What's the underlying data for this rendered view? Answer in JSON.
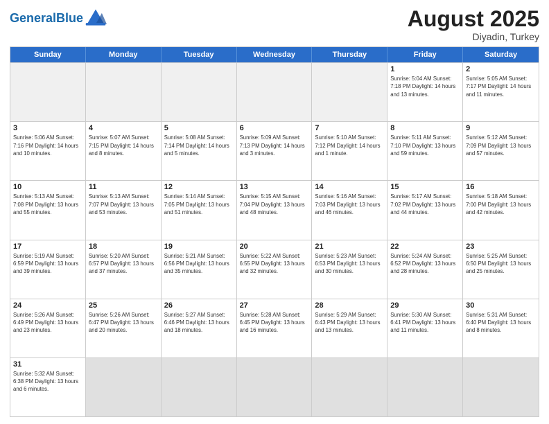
{
  "header": {
    "logo_general": "General",
    "logo_blue": "Blue",
    "title": "August 2025",
    "location": "Diyadin, Turkey"
  },
  "days_of_week": [
    "Sunday",
    "Monday",
    "Tuesday",
    "Wednesday",
    "Thursday",
    "Friday",
    "Saturday"
  ],
  "weeks": [
    [
      {
        "day": "",
        "info": "",
        "empty": true
      },
      {
        "day": "",
        "info": "",
        "empty": true
      },
      {
        "day": "",
        "info": "",
        "empty": true
      },
      {
        "day": "",
        "info": "",
        "empty": true
      },
      {
        "day": "",
        "info": "",
        "empty": true
      },
      {
        "day": "1",
        "info": "Sunrise: 5:04 AM\nSunset: 7:18 PM\nDaylight: 14 hours\nand 13 minutes."
      },
      {
        "day": "2",
        "info": "Sunrise: 5:05 AM\nSunset: 7:17 PM\nDaylight: 14 hours\nand 11 minutes."
      }
    ],
    [
      {
        "day": "3",
        "info": "Sunrise: 5:06 AM\nSunset: 7:16 PM\nDaylight: 14 hours\nand 10 minutes."
      },
      {
        "day": "4",
        "info": "Sunrise: 5:07 AM\nSunset: 7:15 PM\nDaylight: 14 hours\nand 8 minutes."
      },
      {
        "day": "5",
        "info": "Sunrise: 5:08 AM\nSunset: 7:14 PM\nDaylight: 14 hours\nand 5 minutes."
      },
      {
        "day": "6",
        "info": "Sunrise: 5:09 AM\nSunset: 7:13 PM\nDaylight: 14 hours\nand 3 minutes."
      },
      {
        "day": "7",
        "info": "Sunrise: 5:10 AM\nSunset: 7:12 PM\nDaylight: 14 hours\nand 1 minute."
      },
      {
        "day": "8",
        "info": "Sunrise: 5:11 AM\nSunset: 7:10 PM\nDaylight: 13 hours\nand 59 minutes."
      },
      {
        "day": "9",
        "info": "Sunrise: 5:12 AM\nSunset: 7:09 PM\nDaylight: 13 hours\nand 57 minutes."
      }
    ],
    [
      {
        "day": "10",
        "info": "Sunrise: 5:13 AM\nSunset: 7:08 PM\nDaylight: 13 hours\nand 55 minutes."
      },
      {
        "day": "11",
        "info": "Sunrise: 5:13 AM\nSunset: 7:07 PM\nDaylight: 13 hours\nand 53 minutes."
      },
      {
        "day": "12",
        "info": "Sunrise: 5:14 AM\nSunset: 7:05 PM\nDaylight: 13 hours\nand 51 minutes."
      },
      {
        "day": "13",
        "info": "Sunrise: 5:15 AM\nSunset: 7:04 PM\nDaylight: 13 hours\nand 48 minutes."
      },
      {
        "day": "14",
        "info": "Sunrise: 5:16 AM\nSunset: 7:03 PM\nDaylight: 13 hours\nand 46 minutes."
      },
      {
        "day": "15",
        "info": "Sunrise: 5:17 AM\nSunset: 7:02 PM\nDaylight: 13 hours\nand 44 minutes."
      },
      {
        "day": "16",
        "info": "Sunrise: 5:18 AM\nSunset: 7:00 PM\nDaylight: 13 hours\nand 42 minutes."
      }
    ],
    [
      {
        "day": "17",
        "info": "Sunrise: 5:19 AM\nSunset: 6:59 PM\nDaylight: 13 hours\nand 39 minutes."
      },
      {
        "day": "18",
        "info": "Sunrise: 5:20 AM\nSunset: 6:57 PM\nDaylight: 13 hours\nand 37 minutes."
      },
      {
        "day": "19",
        "info": "Sunrise: 5:21 AM\nSunset: 6:56 PM\nDaylight: 13 hours\nand 35 minutes."
      },
      {
        "day": "20",
        "info": "Sunrise: 5:22 AM\nSunset: 6:55 PM\nDaylight: 13 hours\nand 32 minutes."
      },
      {
        "day": "21",
        "info": "Sunrise: 5:23 AM\nSunset: 6:53 PM\nDaylight: 13 hours\nand 30 minutes."
      },
      {
        "day": "22",
        "info": "Sunrise: 5:24 AM\nSunset: 6:52 PM\nDaylight: 13 hours\nand 28 minutes."
      },
      {
        "day": "23",
        "info": "Sunrise: 5:25 AM\nSunset: 6:50 PM\nDaylight: 13 hours\nand 25 minutes."
      }
    ],
    [
      {
        "day": "24",
        "info": "Sunrise: 5:26 AM\nSunset: 6:49 PM\nDaylight: 13 hours\nand 23 minutes."
      },
      {
        "day": "25",
        "info": "Sunrise: 5:26 AM\nSunset: 6:47 PM\nDaylight: 13 hours\nand 20 minutes."
      },
      {
        "day": "26",
        "info": "Sunrise: 5:27 AM\nSunset: 6:46 PM\nDaylight: 13 hours\nand 18 minutes."
      },
      {
        "day": "27",
        "info": "Sunrise: 5:28 AM\nSunset: 6:45 PM\nDaylight: 13 hours\nand 16 minutes."
      },
      {
        "day": "28",
        "info": "Sunrise: 5:29 AM\nSunset: 6:43 PM\nDaylight: 13 hours\nand 13 minutes."
      },
      {
        "day": "29",
        "info": "Sunrise: 5:30 AM\nSunset: 6:41 PM\nDaylight: 13 hours\nand 11 minutes."
      },
      {
        "day": "30",
        "info": "Sunrise: 5:31 AM\nSunset: 6:40 PM\nDaylight: 13 hours\nand 8 minutes."
      }
    ],
    [
      {
        "day": "31",
        "info": "Sunrise: 5:32 AM\nSunset: 6:38 PM\nDaylight: 13 hours\nand 6 minutes."
      },
      {
        "day": "",
        "info": "",
        "empty": true
      },
      {
        "day": "",
        "info": "",
        "empty": true
      },
      {
        "day": "",
        "info": "",
        "empty": true
      },
      {
        "day": "",
        "info": "",
        "empty": true
      },
      {
        "day": "",
        "info": "",
        "empty": true
      },
      {
        "day": "",
        "info": "",
        "empty": true
      }
    ]
  ]
}
